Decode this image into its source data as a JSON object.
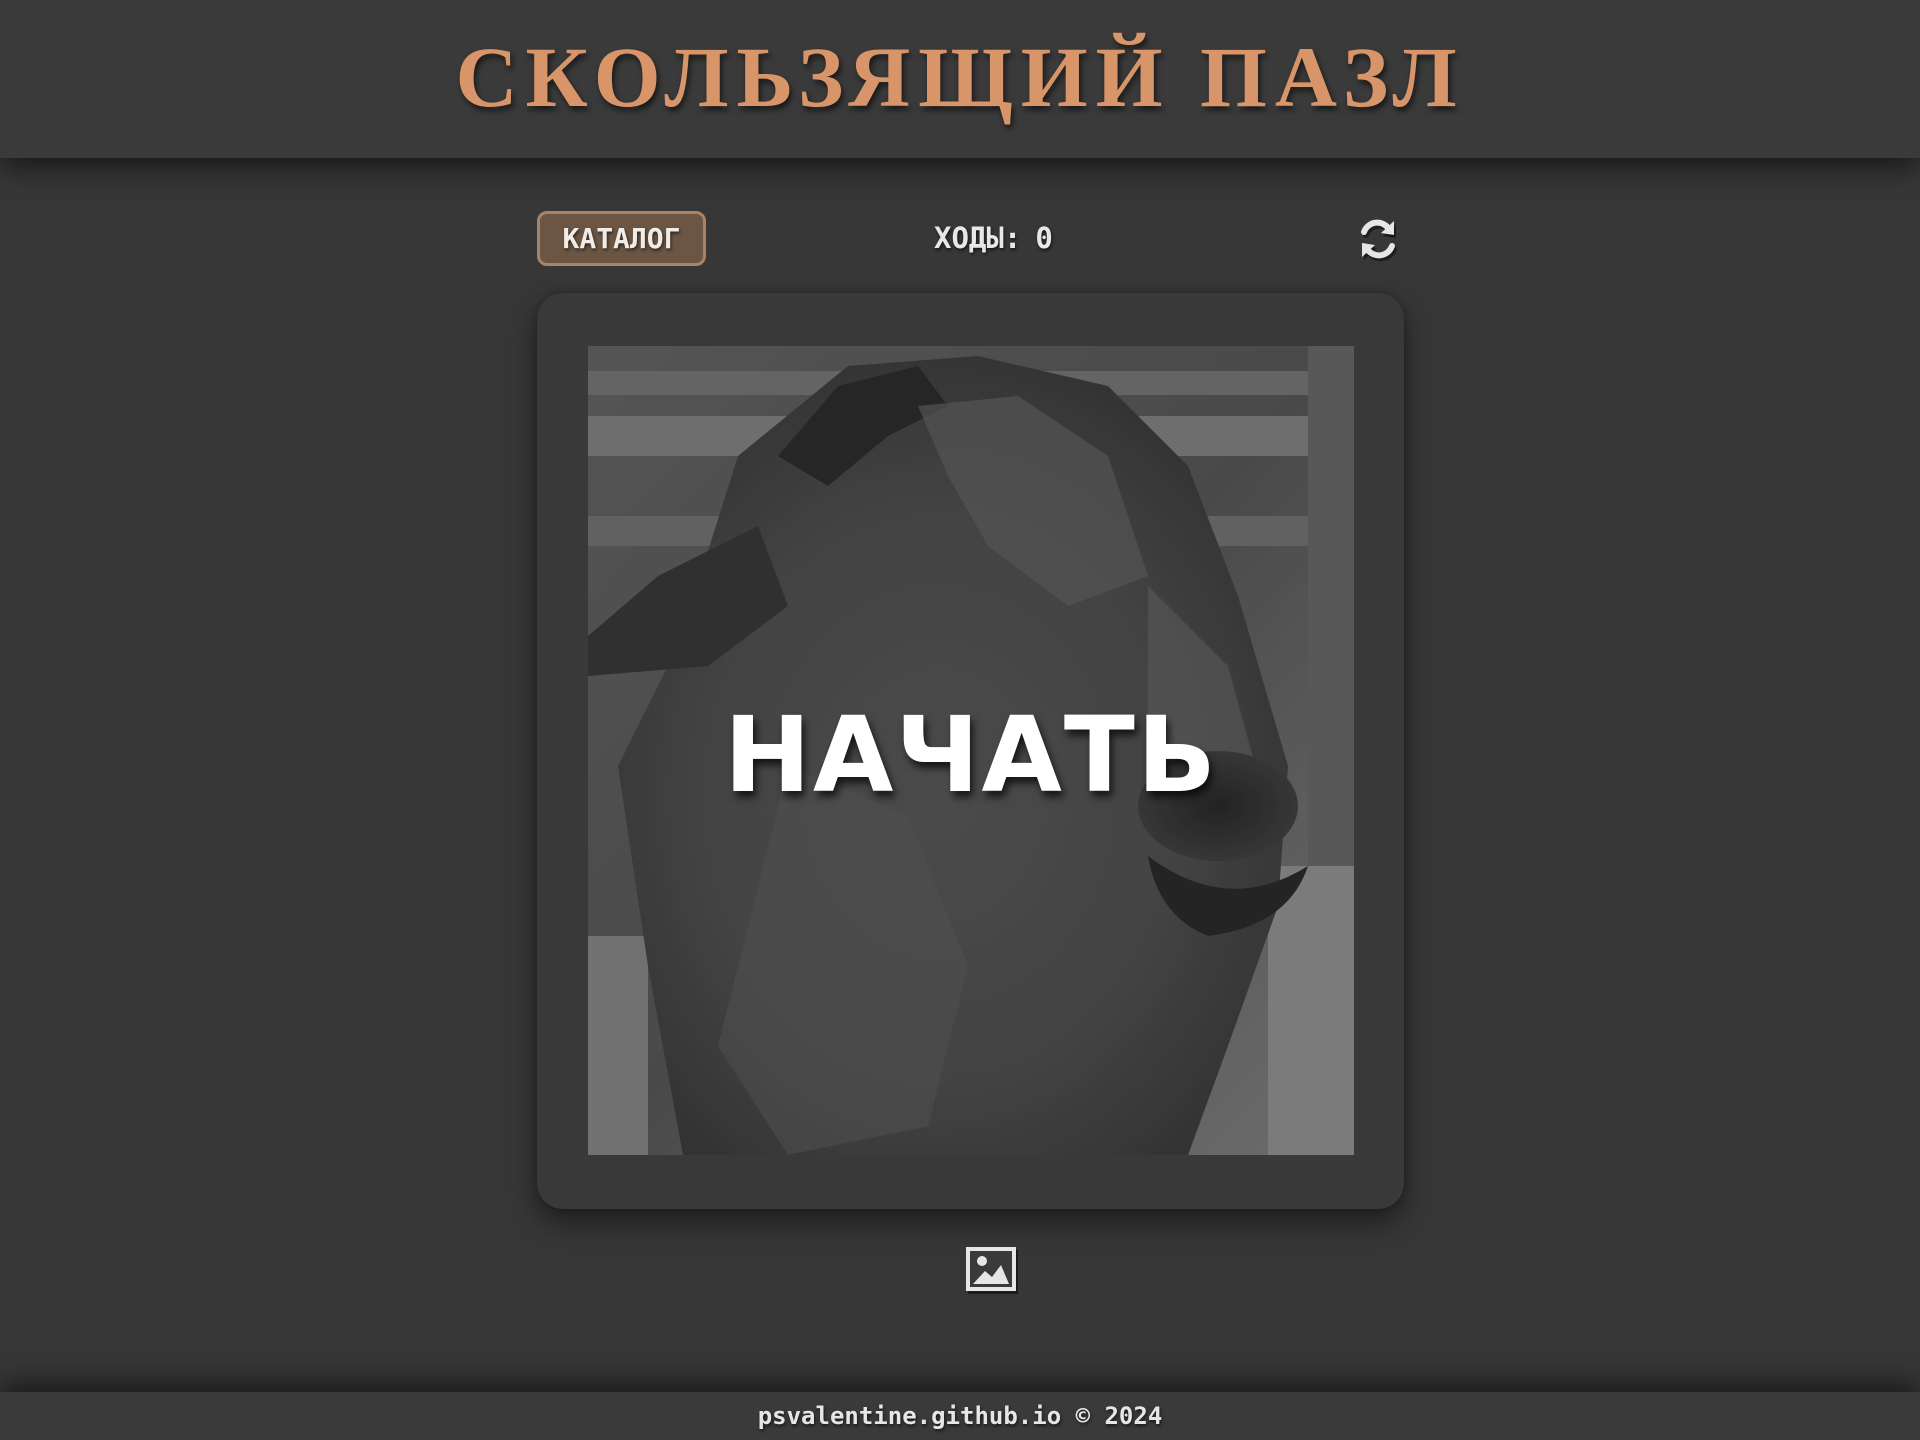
{
  "header": {
    "title": "СКОЛЬЗЯЩИЙ ПАЗЛ"
  },
  "toolbar": {
    "catalog_label": "КАТАЛОГ",
    "moves_label": "ХОДЫ:",
    "moves_count": "0",
    "refresh_icon": "refresh-icon"
  },
  "board": {
    "start_label": "НАЧАТЬ",
    "image_subject": "alpaca"
  },
  "controls": {
    "image_icon": "image-icon"
  },
  "footer": {
    "text": "psvalentine.github.io © 2024"
  },
  "colors": {
    "background": "#373737",
    "title": "#d8956a",
    "catalog_button_bg": "#6b5644",
    "catalog_button_border": "#a88464"
  }
}
